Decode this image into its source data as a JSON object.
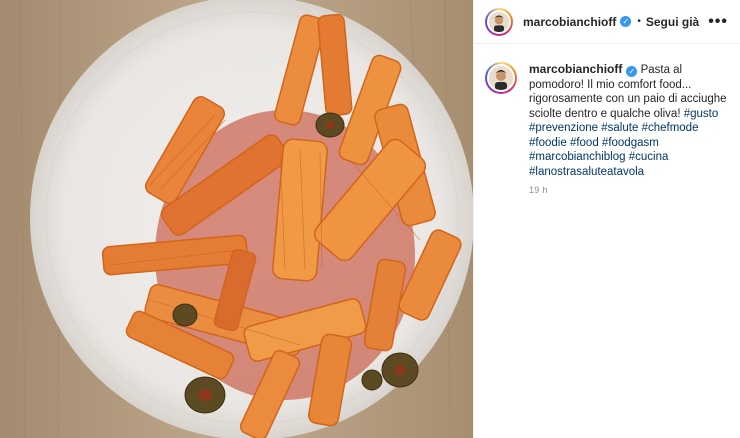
{
  "header": {
    "username": "marcobianchioff",
    "separator": "•",
    "follow_label": "Segui già",
    "more_label": "•••"
  },
  "caption": {
    "username": "marcobianchioff",
    "text": "Pasta al pomodoro! Il mio comfort food... rigorosamente con un paio di acciughe sciolte dentro e qualche oliva!",
    "hashtags": [
      "#gusto",
      "#prevenzione",
      "#salute",
      "#chefmode",
      "#foodie",
      "#food",
      "#foodgasm",
      "#marcobianchiblog",
      "#cucina",
      "#lanostrasaluteatavola"
    ],
    "timestamp": "19 h"
  },
  "icons": {
    "verified": "verified-badge-icon",
    "more": "more-options-icon"
  },
  "colors": {
    "verified": "#3897f0",
    "hashtag": "#00376b",
    "timestamp": "#8e8e8e"
  }
}
